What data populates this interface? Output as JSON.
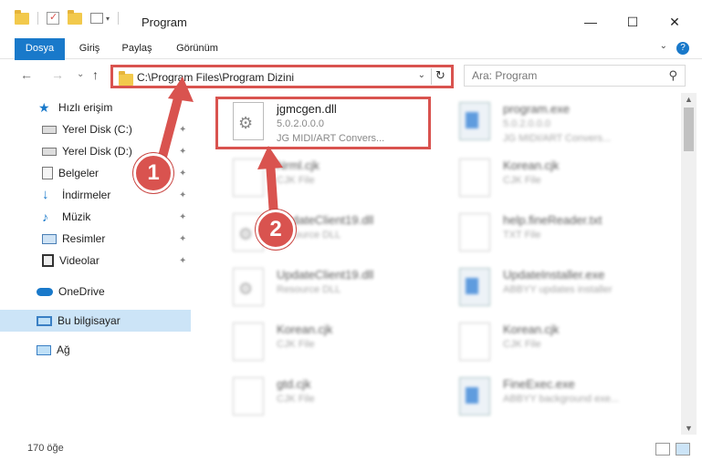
{
  "window": {
    "title": "Program",
    "minimize": "—",
    "maximize": "☐",
    "close": "✕"
  },
  "ribbon": {
    "tabs": [
      "Dosya",
      "Giriş",
      "Paylaş",
      "Görünüm"
    ],
    "expand": "⌄",
    "help": "?"
  },
  "nav": {
    "back": "←",
    "forward": "→",
    "recent": "⌄",
    "up": "↑",
    "address": "C:\\Program Files\\Program Dizini",
    "address_dropdown": "⌄",
    "refresh": "↻",
    "search_placeholder": "Ara: Program",
    "search_icon": "⚲"
  },
  "sidebar": {
    "items": [
      {
        "label": "Hızlı erişim",
        "icon": "star-icon",
        "pinned": false
      },
      {
        "label": "Yerel Disk (C:)",
        "icon": "drive-icon",
        "pinned": true
      },
      {
        "label": "Yerel Disk (D:)",
        "icon": "drive-icon",
        "pinned": true
      },
      {
        "label": "Belgeler",
        "icon": "documents-icon",
        "pinned": true
      },
      {
        "label": "İndirmeler",
        "icon": "download-icon",
        "pinned": true
      },
      {
        "label": "Müzik",
        "icon": "music-icon",
        "pinned": true
      },
      {
        "label": "Resimler",
        "icon": "pictures-icon",
        "pinned": true
      },
      {
        "label": "Videolar",
        "icon": "videos-icon",
        "pinned": true
      },
      {
        "label": "OneDrive",
        "icon": "cloud-icon",
        "pinned": false
      },
      {
        "label": "Bu bilgisayar",
        "icon": "computer-icon",
        "pinned": false
      },
      {
        "label": "Ağ",
        "icon": "network-icon",
        "pinned": false
      }
    ],
    "pin_glyph": "📌"
  },
  "files": [
    {
      "name": "jgmcgen.dll",
      "line1": "5.0.2.0.0.0",
      "line2": "JG MIDI/ART Convers...",
      "icon": "gear-file-icon"
    },
    {
      "name": "program.exe",
      "line1": "5.0.2.0.0.0",
      "line2": "JG MIDI/ART Convers...",
      "icon": "exe-icon"
    },
    {
      "name": "Nrml.cjk",
      "line1": "CJK File",
      "line2": "",
      "icon": "blank-file-icon"
    },
    {
      "name": "Korean.cjk",
      "line1": "CJK File",
      "line2": "",
      "icon": "blank-file-icon"
    },
    {
      "name": "UpdateClient19.dll",
      "line1": "Resource DLL",
      "line2": "",
      "icon": "gear-file-icon"
    },
    {
      "name": "help.fineReader.txt",
      "line1": "TXT File",
      "line2": "",
      "icon": "blank-file-icon"
    },
    {
      "name": "UpdateClient19.dll",
      "line1": "Resource DLL",
      "line2": "",
      "icon": "gear-file-icon"
    },
    {
      "name": "UpdateInstaller.exe",
      "line1": "ABBYY updates installer",
      "line2": "",
      "icon": "exe-icon"
    },
    {
      "name": "Korean.cjk",
      "line1": "CJK File",
      "line2": "",
      "icon": "blank-file-icon"
    },
    {
      "name": "Korean.cjk",
      "line1": "CJK File",
      "line2": "",
      "icon": "blank-file-icon"
    },
    {
      "name": "gtd.cjk",
      "line1": "CJK File",
      "line2": "",
      "icon": "blank-file-icon"
    },
    {
      "name": "FineExec.exe",
      "line1": "ABBYY background exe...",
      "line2": "",
      "icon": "exe-icon"
    }
  ],
  "status": {
    "count": "170 öğe"
  },
  "annotations": {
    "step1": "1",
    "step2": "2",
    "color": "#d9534f"
  }
}
